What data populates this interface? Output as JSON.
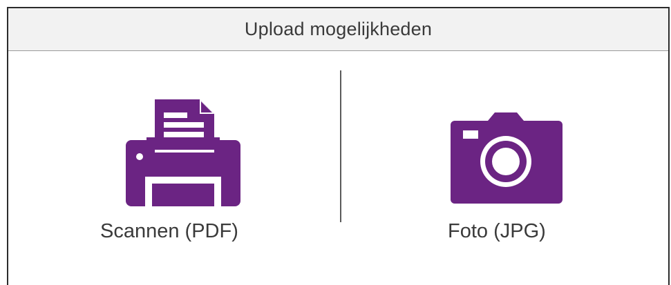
{
  "header": {
    "title": "Upload mogelijkheden"
  },
  "options": [
    {
      "label": "Scannen (PDF)",
      "icon": "printer-icon"
    },
    {
      "label": "Foto (JPG)",
      "icon": "camera-icon"
    }
  ],
  "colors": {
    "icon": "#6b2483",
    "text": "#3a3a3a",
    "header_bg": "#f2f2f2",
    "border": "#2b2b2b"
  }
}
